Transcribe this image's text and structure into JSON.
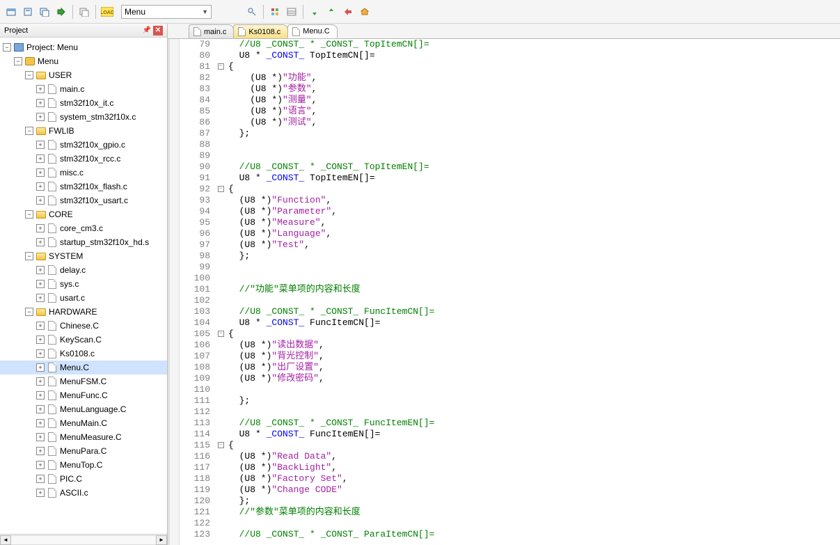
{
  "toolbar": {
    "combo1_value": "Menu",
    "combo2_value": ""
  },
  "panel": {
    "title": "Project"
  },
  "tree": {
    "root": "Project: Menu",
    "target": "Menu",
    "groups": [
      {
        "name": "USER",
        "files": [
          "main.c",
          "stm32f10x_it.c",
          "system_stm32f10x.c"
        ]
      },
      {
        "name": "FWLIB",
        "files": [
          "stm32f10x_gpio.c",
          "stm32f10x_rcc.c",
          "misc.c",
          "stm32f10x_flash.c",
          "stm32f10x_usart.c"
        ]
      },
      {
        "name": "CORE",
        "files": [
          "core_cm3.c",
          "startup_stm32f10x_hd.s"
        ]
      },
      {
        "name": "SYSTEM",
        "files": [
          "delay.c",
          "sys.c",
          "usart.c"
        ]
      },
      {
        "name": "HARDWARE",
        "files": [
          "Chinese.C",
          "KeyScan.C",
          "Ks0108.c",
          "Menu.C",
          "MenuFSM.C",
          "MenuFunc.C",
          "MenuLanguage.C",
          "MenuMain.C",
          "MenuMeasure.C",
          "MenuPara.C",
          "MenuTop.C",
          "PIC.C",
          "ASCII.c"
        ]
      }
    ],
    "selected": "Menu.C"
  },
  "tabs": [
    {
      "label": "main.c",
      "modified": false,
      "active": false
    },
    {
      "label": "Ks0108.c",
      "modified": true,
      "active": false
    },
    {
      "label": "Menu.C",
      "modified": false,
      "active": true
    }
  ],
  "code": {
    "first_line": 79,
    "lines": [
      {
        "n": 79,
        "t": "  //U8 _CONST_ * _CONST_ TopItemCN[]=",
        "cls": "c-comment"
      },
      {
        "n": 80,
        "t_parts": [
          [
            "  U8 * ",
            ""
          ],
          [
            "_CONST_",
            "c-kw"
          ],
          [
            " TopItemCN[]=",
            ""
          ]
        ]
      },
      {
        "n": 81,
        "fold": "-",
        "t": "{"
      },
      {
        "n": 82,
        "t_parts": [
          [
            "    (U8 *)",
            ""
          ],
          [
            "\"功能\"",
            "c-str"
          ],
          [
            ",",
            ""
          ]
        ]
      },
      {
        "n": 83,
        "t_parts": [
          [
            "    (U8 *)",
            ""
          ],
          [
            "\"参数\"",
            "c-str"
          ],
          [
            ",",
            ""
          ]
        ]
      },
      {
        "n": 84,
        "t_parts": [
          [
            "    (U8 *)",
            ""
          ],
          [
            "\"测量\"",
            "c-str"
          ],
          [
            ",",
            ""
          ]
        ]
      },
      {
        "n": 85,
        "t_parts": [
          [
            "    (U8 *)",
            ""
          ],
          [
            "\"语言\"",
            "c-str"
          ],
          [
            ",",
            ""
          ]
        ]
      },
      {
        "n": 86,
        "t_parts": [
          [
            "    (U8 *)",
            ""
          ],
          [
            "\"测试\"",
            "c-str"
          ],
          [
            ",",
            ""
          ]
        ]
      },
      {
        "n": 87,
        "t": "  };"
      },
      {
        "n": 88,
        "t": ""
      },
      {
        "n": 89,
        "t": ""
      },
      {
        "n": 90,
        "t": "  //U8 _CONST_ * _CONST_ TopItemEN[]=",
        "cls": "c-comment"
      },
      {
        "n": 91,
        "t_parts": [
          [
            "  U8 * ",
            ""
          ],
          [
            "_CONST_",
            "c-kw"
          ],
          [
            " TopItemEN[]=",
            ""
          ]
        ]
      },
      {
        "n": 92,
        "fold": "-",
        "t": "{"
      },
      {
        "n": 93,
        "t_parts": [
          [
            "  (U8 *)",
            ""
          ],
          [
            "\"Function\"",
            "c-str"
          ],
          [
            ",",
            ""
          ]
        ]
      },
      {
        "n": 94,
        "t_parts": [
          [
            "  (U8 *)",
            ""
          ],
          [
            "\"Parameter\"",
            "c-str"
          ],
          [
            ",",
            ""
          ]
        ]
      },
      {
        "n": 95,
        "t_parts": [
          [
            "  (U8 *)",
            ""
          ],
          [
            "\"Measure\"",
            "c-str"
          ],
          [
            ",",
            ""
          ]
        ]
      },
      {
        "n": 96,
        "t_parts": [
          [
            "  (U8 *)",
            ""
          ],
          [
            "\"Language\"",
            "c-str"
          ],
          [
            ",",
            ""
          ]
        ]
      },
      {
        "n": 97,
        "t_parts": [
          [
            "  (U8 *)",
            ""
          ],
          [
            "\"Test\"",
            "c-str"
          ],
          [
            ",",
            ""
          ]
        ]
      },
      {
        "n": 98,
        "t": "  };"
      },
      {
        "n": 99,
        "t": ""
      },
      {
        "n": 100,
        "t": ""
      },
      {
        "n": 101,
        "t": "  //\"功能\"菜单项的内容和长度",
        "cls": "c-comment"
      },
      {
        "n": 102,
        "t": ""
      },
      {
        "n": 103,
        "t": "  //U8 _CONST_ * _CONST_ FuncItemCN[]=",
        "cls": "c-comment"
      },
      {
        "n": 104,
        "t_parts": [
          [
            "  U8 * ",
            ""
          ],
          [
            "_CONST_",
            "c-kw"
          ],
          [
            " FuncItemCN[]=",
            ""
          ]
        ]
      },
      {
        "n": 105,
        "fold": "-",
        "t": "{"
      },
      {
        "n": 106,
        "t_parts": [
          [
            "  (U8 *)",
            ""
          ],
          [
            "\"读出数据\"",
            "c-str"
          ],
          [
            ",",
            ""
          ]
        ]
      },
      {
        "n": 107,
        "t_parts": [
          [
            "  (U8 *)",
            ""
          ],
          [
            "\"背光控制\"",
            "c-str"
          ],
          [
            ",",
            ""
          ]
        ]
      },
      {
        "n": 108,
        "t_parts": [
          [
            "  (U8 *)",
            ""
          ],
          [
            "\"出厂设置\"",
            "c-str"
          ],
          [
            ",",
            ""
          ]
        ]
      },
      {
        "n": 109,
        "t_parts": [
          [
            "  (U8 *)",
            ""
          ],
          [
            "\"修改密码\"",
            "c-str"
          ],
          [
            ",",
            ""
          ]
        ]
      },
      {
        "n": 110,
        "t": ""
      },
      {
        "n": 111,
        "t": "  };"
      },
      {
        "n": 112,
        "t": ""
      },
      {
        "n": 113,
        "t": "  //U8 _CONST_ * _CONST_ FuncItemEN[]=",
        "cls": "c-comment"
      },
      {
        "n": 114,
        "t_parts": [
          [
            "  U8 * ",
            ""
          ],
          [
            "_CONST_",
            "c-kw"
          ],
          [
            " FuncItemEN[]=",
            ""
          ]
        ]
      },
      {
        "n": 115,
        "fold": "-",
        "t": "{"
      },
      {
        "n": 116,
        "t_parts": [
          [
            "  (U8 *)",
            ""
          ],
          [
            "\"Read Data\"",
            "c-str"
          ],
          [
            ",",
            ""
          ]
        ]
      },
      {
        "n": 117,
        "t_parts": [
          [
            "  (U8 *)",
            ""
          ],
          [
            "\"BackLight\"",
            "c-str"
          ],
          [
            ",",
            ""
          ]
        ]
      },
      {
        "n": 118,
        "t_parts": [
          [
            "  (U8 *)",
            ""
          ],
          [
            "\"Factory Set\"",
            "c-str"
          ],
          [
            ",",
            ""
          ]
        ]
      },
      {
        "n": 119,
        "t_parts": [
          [
            "  (U8 *)",
            ""
          ],
          [
            "\"Change CODE\"",
            "c-str"
          ]
        ]
      },
      {
        "n": 120,
        "t": "  };"
      },
      {
        "n": 121,
        "t": "  //\"参数\"菜单项的内容和长度",
        "cls": "c-comment"
      },
      {
        "n": 122,
        "t": ""
      },
      {
        "n": 123,
        "t": "  //U8 _CONST_ * _CONST_ ParaItemCN[]=",
        "cls": "c-comment"
      }
    ]
  }
}
